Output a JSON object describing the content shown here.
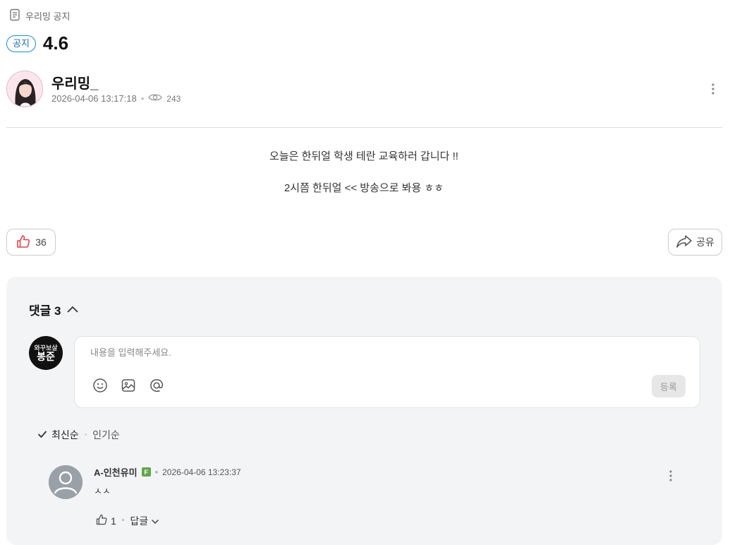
{
  "breadcrumb": {
    "label": "우리밍 공지"
  },
  "post": {
    "badge": "공지",
    "title": "4.6",
    "author": "우리밍_",
    "datetime": "2026-04-06 13:17:18",
    "views": "243",
    "body": [
      "오늘은 한뒤얼 학생 테란 교육하러 갑니다 !!",
      "2시쯤 한뒤얼 << 방송으로 봐용 ㅎㅎ"
    ],
    "likes": "36",
    "share_label": "공유"
  },
  "comments": {
    "header": "댓글 3",
    "placeholder": "내용을 입력해주세요.",
    "submit_label": "등록",
    "my_avatar_text": {
      "top": "와꾸보살",
      "bottom": "봉준"
    },
    "sort": {
      "active": "최신순",
      "other": "인기순"
    },
    "items": [
      {
        "author": "A-인천유미",
        "badge": "F",
        "datetime": "2026-04-06 13:23:37",
        "text": "ㅅㅅ",
        "likes": "1",
        "reply_label": "답글"
      }
    ]
  },
  "colors": {
    "accent": "#1a8cd8",
    "like": "#e0464f",
    "panel": "#f3f4f6",
    "badge_green": "#63a64b"
  }
}
